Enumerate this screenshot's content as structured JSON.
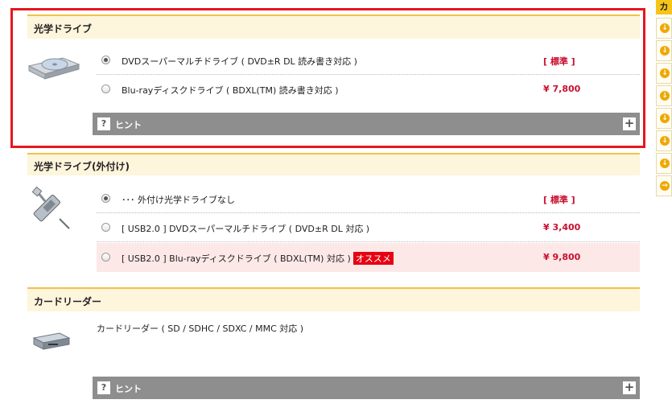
{
  "sidebar": {
    "title": "カ",
    "items": [
      {
        "icon": "arrow-down-circle-icon"
      },
      {
        "icon": "arrow-down-circle-icon"
      },
      {
        "icon": "arrow-down-circle-icon"
      },
      {
        "icon": "arrow-down-circle-icon"
      },
      {
        "icon": "arrow-down-circle-icon"
      },
      {
        "icon": "arrow-down-circle-icon"
      },
      {
        "icon": "arrow-down-circle-icon"
      },
      {
        "icon": "arrow-right-circle-icon"
      }
    ]
  },
  "sections": {
    "optical": {
      "title": "光学ドライブ",
      "options": [
        {
          "label": "DVDスーパーマルチドライブ ( DVD±R DL 読み書き対応 )",
          "price": "[ 標準 ]",
          "selected": true
        },
        {
          "label": "Blu-rayディスクドライブ ( BDXL(TM) 読み書き対応 )",
          "price": "¥ 7,800",
          "selected": false
        }
      ],
      "hint": "ヒント"
    },
    "external": {
      "title": "光学ドライブ(外付け)",
      "options": [
        {
          "label": "･･･ 外付け光学ドライブなし",
          "price": "[ 標準 ]",
          "selected": true
        },
        {
          "label": "[ USB2.0 ] DVDスーパーマルチドライブ ( DVD±R DL 対応 )",
          "price": "¥ 3,400",
          "selected": false
        },
        {
          "label": "[ USB2.0 ] Blu-rayディスクドライブ ( BDXL(TM) 対応 )",
          "badge": "オススメ",
          "price": "¥ 9,800",
          "selected": false
        }
      ]
    },
    "card": {
      "title": "カードリーダー",
      "description": "カードリーダー ( SD / SDHC / SDXC / MMC 対応 )",
      "hint": "ヒント"
    }
  },
  "hint_symbols": {
    "question": "?",
    "expand": "+"
  },
  "colors": {
    "accent": "#f0c24a",
    "price": "#c8102e",
    "highlight": "#e5171f",
    "recommend_badge": "#e60012"
  }
}
